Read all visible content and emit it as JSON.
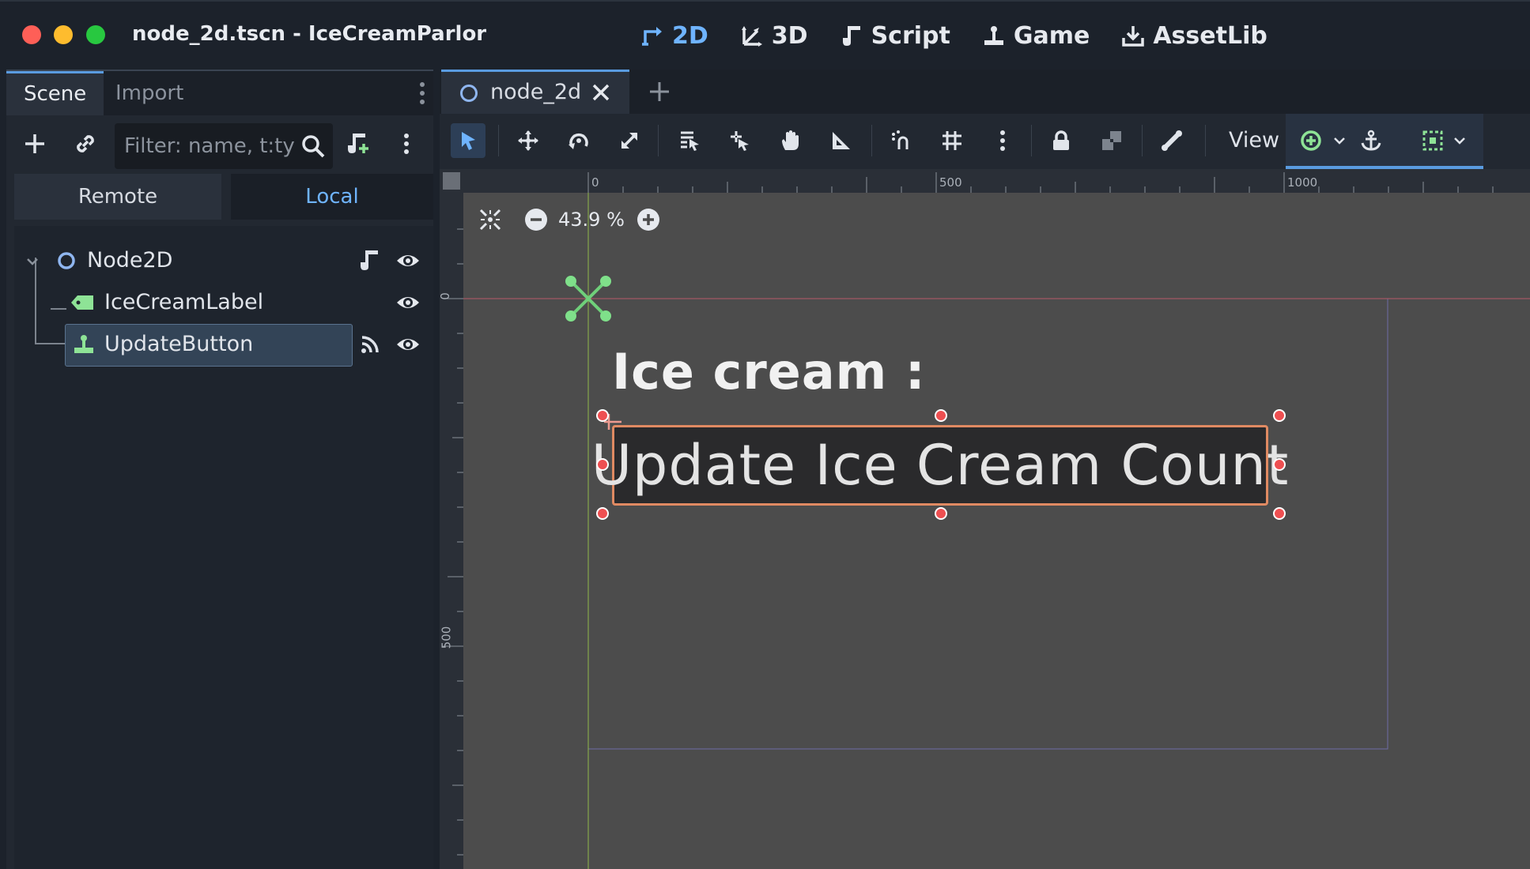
{
  "window": {
    "title": "node_2d.tscn - IceCreamParlor"
  },
  "main_tabs": [
    {
      "label": "2D",
      "icon": "2d-icon",
      "active": true
    },
    {
      "label": "3D",
      "icon": "3d-icon",
      "active": false
    },
    {
      "label": "Script",
      "icon": "script-icon",
      "active": false
    },
    {
      "label": "Game",
      "icon": "game-icon",
      "active": false
    },
    {
      "label": "AssetLib",
      "icon": "assetlib-icon",
      "active": false
    }
  ],
  "dock": {
    "tabs": [
      "Scene",
      "Import"
    ],
    "filter_placeholder": "Filter: name, t:ty",
    "toggle": {
      "remote": "Remote",
      "local": "Local"
    },
    "tree": [
      {
        "label": "Node2D",
        "icon": "node2d-icon"
      },
      {
        "label": "IceCreamLabel",
        "icon": "label-icon"
      },
      {
        "label": "UpdateButton",
        "icon": "button-icon",
        "selected": true
      }
    ]
  },
  "editor": {
    "tab_name": "node_2d",
    "view_label": "View",
    "zoom": "43.9 %",
    "ruler_top": [
      "0",
      "500",
      "1000"
    ],
    "ruler_left": [
      "0",
      "500"
    ]
  },
  "canvas": {
    "label_text": "Ice cream :",
    "button_text": "Update Ice Cream Count"
  },
  "colors": {
    "accent": "#6fb4ff",
    "selection_outline": "#e08a62",
    "handle": "#ee4f51",
    "node_green": "#8ee396"
  }
}
